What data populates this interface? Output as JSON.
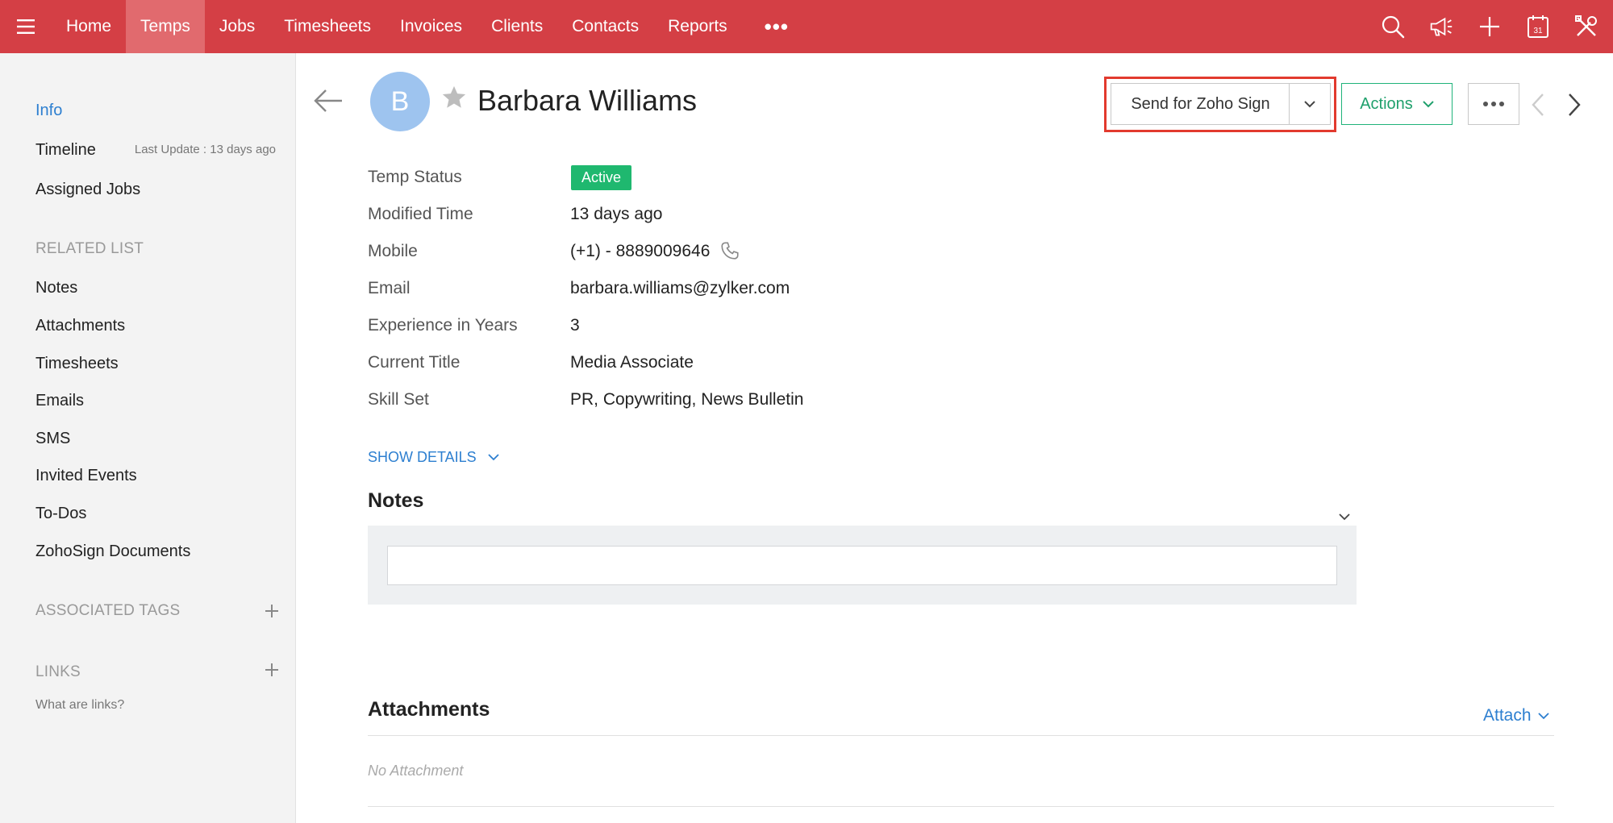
{
  "nav": {
    "tabs": [
      "Home",
      "Temps",
      "Jobs",
      "Timesheets",
      "Invoices",
      "Clients",
      "Contacts",
      "Reports"
    ],
    "active_tab": "Temps",
    "more_label": "•••",
    "icons": [
      "search-icon",
      "megaphone-icon",
      "plus-icon",
      "calendar-icon",
      "tools-icon"
    ],
    "calendar_day": "31"
  },
  "sidebar": {
    "info": "Info",
    "timeline": "Timeline",
    "last_update": "Last Update : 13 days ago",
    "assigned_jobs": "Assigned Jobs",
    "related_list_heading": "RELATED LIST",
    "related_items": [
      "Notes",
      "Attachments",
      "Timesheets",
      "Emails",
      "SMS",
      "Invited Events",
      "To-Dos",
      "ZohoSign Documents"
    ],
    "associated_tags_heading": "ASSOCIATED TAGS",
    "links_heading": "LINKS",
    "what_are_links": "What are links?"
  },
  "record": {
    "avatar_initial": "B",
    "name": "Barbara Williams"
  },
  "toolbar": {
    "send_zoho_sign": "Send for Zoho Sign",
    "actions": "Actions",
    "more": "•••"
  },
  "fields": [
    {
      "label": "Temp Status",
      "value": "Active"
    },
    {
      "label": "Modified Time",
      "value": "13 days ago"
    },
    {
      "label": "Mobile",
      "value": "(+1) - 8889009646"
    },
    {
      "label": "Email",
      "value": "barbara.williams@zylker.com"
    },
    {
      "label": "Experience in Years",
      "value": "3"
    },
    {
      "label": "Current Title",
      "value": "Media Associate"
    },
    {
      "label": "Skill Set",
      "value": "PR,  Copywriting, News Bulletin"
    }
  ],
  "show_details": "SHOW DETAILS",
  "notes": {
    "title": "Notes",
    "input_value": ""
  },
  "attachments": {
    "title": "Attachments",
    "attach_label": "Attach",
    "empty_text": "No Attachment"
  },
  "colors": {
    "topbar": "#d43f45",
    "active_tab": "#e16a6e",
    "accent_blue": "#2d7fd0",
    "active_green": "#1fb86f",
    "highlight_red": "#e23a2e"
  }
}
